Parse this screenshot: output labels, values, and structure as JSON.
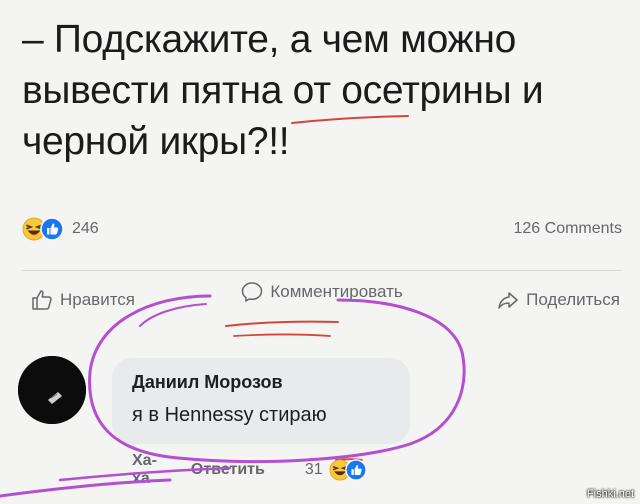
{
  "post": {
    "lines": [
      "– Подскажите, а чем можно",
      "вывести пятна от осетрины и",
      "черной икры?!!"
    ]
  },
  "reactions": {
    "count": "246",
    "comments_label": "126 Comments"
  },
  "actions": {
    "like": "Нравится",
    "comment": "Комментировать",
    "share": "Поделиться"
  },
  "comment": {
    "author": "Даниил Морозов",
    "text": "я в Hennessy стираю",
    "haha_label": "Ха-ха",
    "reply_label": "Ответить",
    "reaction_count": "31"
  },
  "watermark": "Fishki.net",
  "colors": {
    "background": "#f4f4f3",
    "like_blue": "#1877f2",
    "haha_yellow": "#f7c83a",
    "annotation_purple": "#b44fd0",
    "annotation_red": "#d2473a"
  },
  "icons": [
    "haha-emoji-icon",
    "like-reaction-icon",
    "thumbs-up-icon",
    "comment-bubble-icon",
    "share-arrow-icon"
  ]
}
